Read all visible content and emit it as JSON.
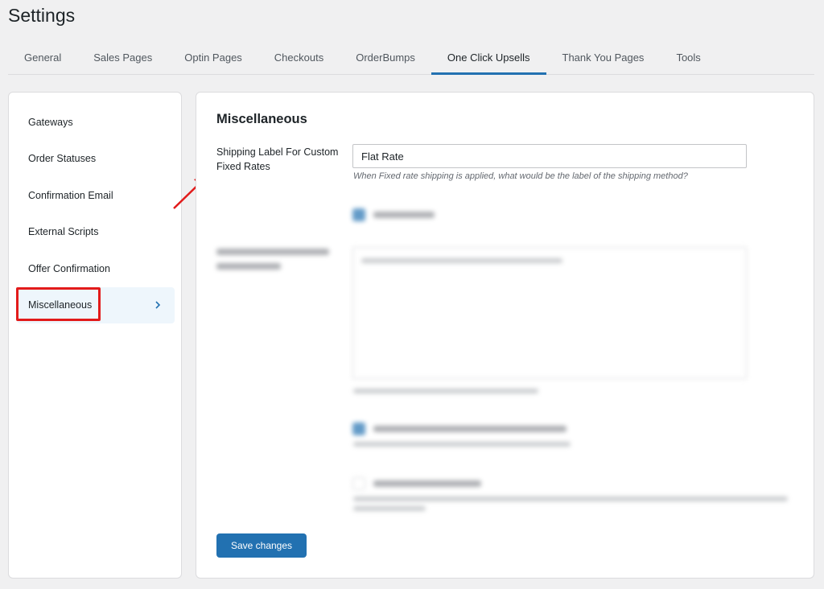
{
  "page": {
    "title": "Settings"
  },
  "tabs": [
    {
      "label": "General"
    },
    {
      "label": "Sales Pages"
    },
    {
      "label": "Optin Pages"
    },
    {
      "label": "Checkouts"
    },
    {
      "label": "OrderBumps"
    },
    {
      "label": "One Click Upsells",
      "active": true
    },
    {
      "label": "Thank You Pages"
    },
    {
      "label": "Tools"
    }
  ],
  "sidebar": {
    "items": [
      {
        "label": "Gateways"
      },
      {
        "label": "Order Statuses"
      },
      {
        "label": "Confirmation Email"
      },
      {
        "label": "External Scripts"
      },
      {
        "label": "Offer Confirmation"
      },
      {
        "label": "Miscellaneous",
        "active": true
      }
    ]
  },
  "main": {
    "section_title": "Miscellaneous",
    "shipping_label": {
      "label": "Shipping Label For Custom Fixed Rates",
      "value": "Flat Rate",
      "description": "When Fixed rate shipping is applied, what would be the label of the shipping method?"
    },
    "save_label": "Save changes"
  },
  "colors": {
    "accent": "#2271b1",
    "highlight": "#e21b1b"
  }
}
